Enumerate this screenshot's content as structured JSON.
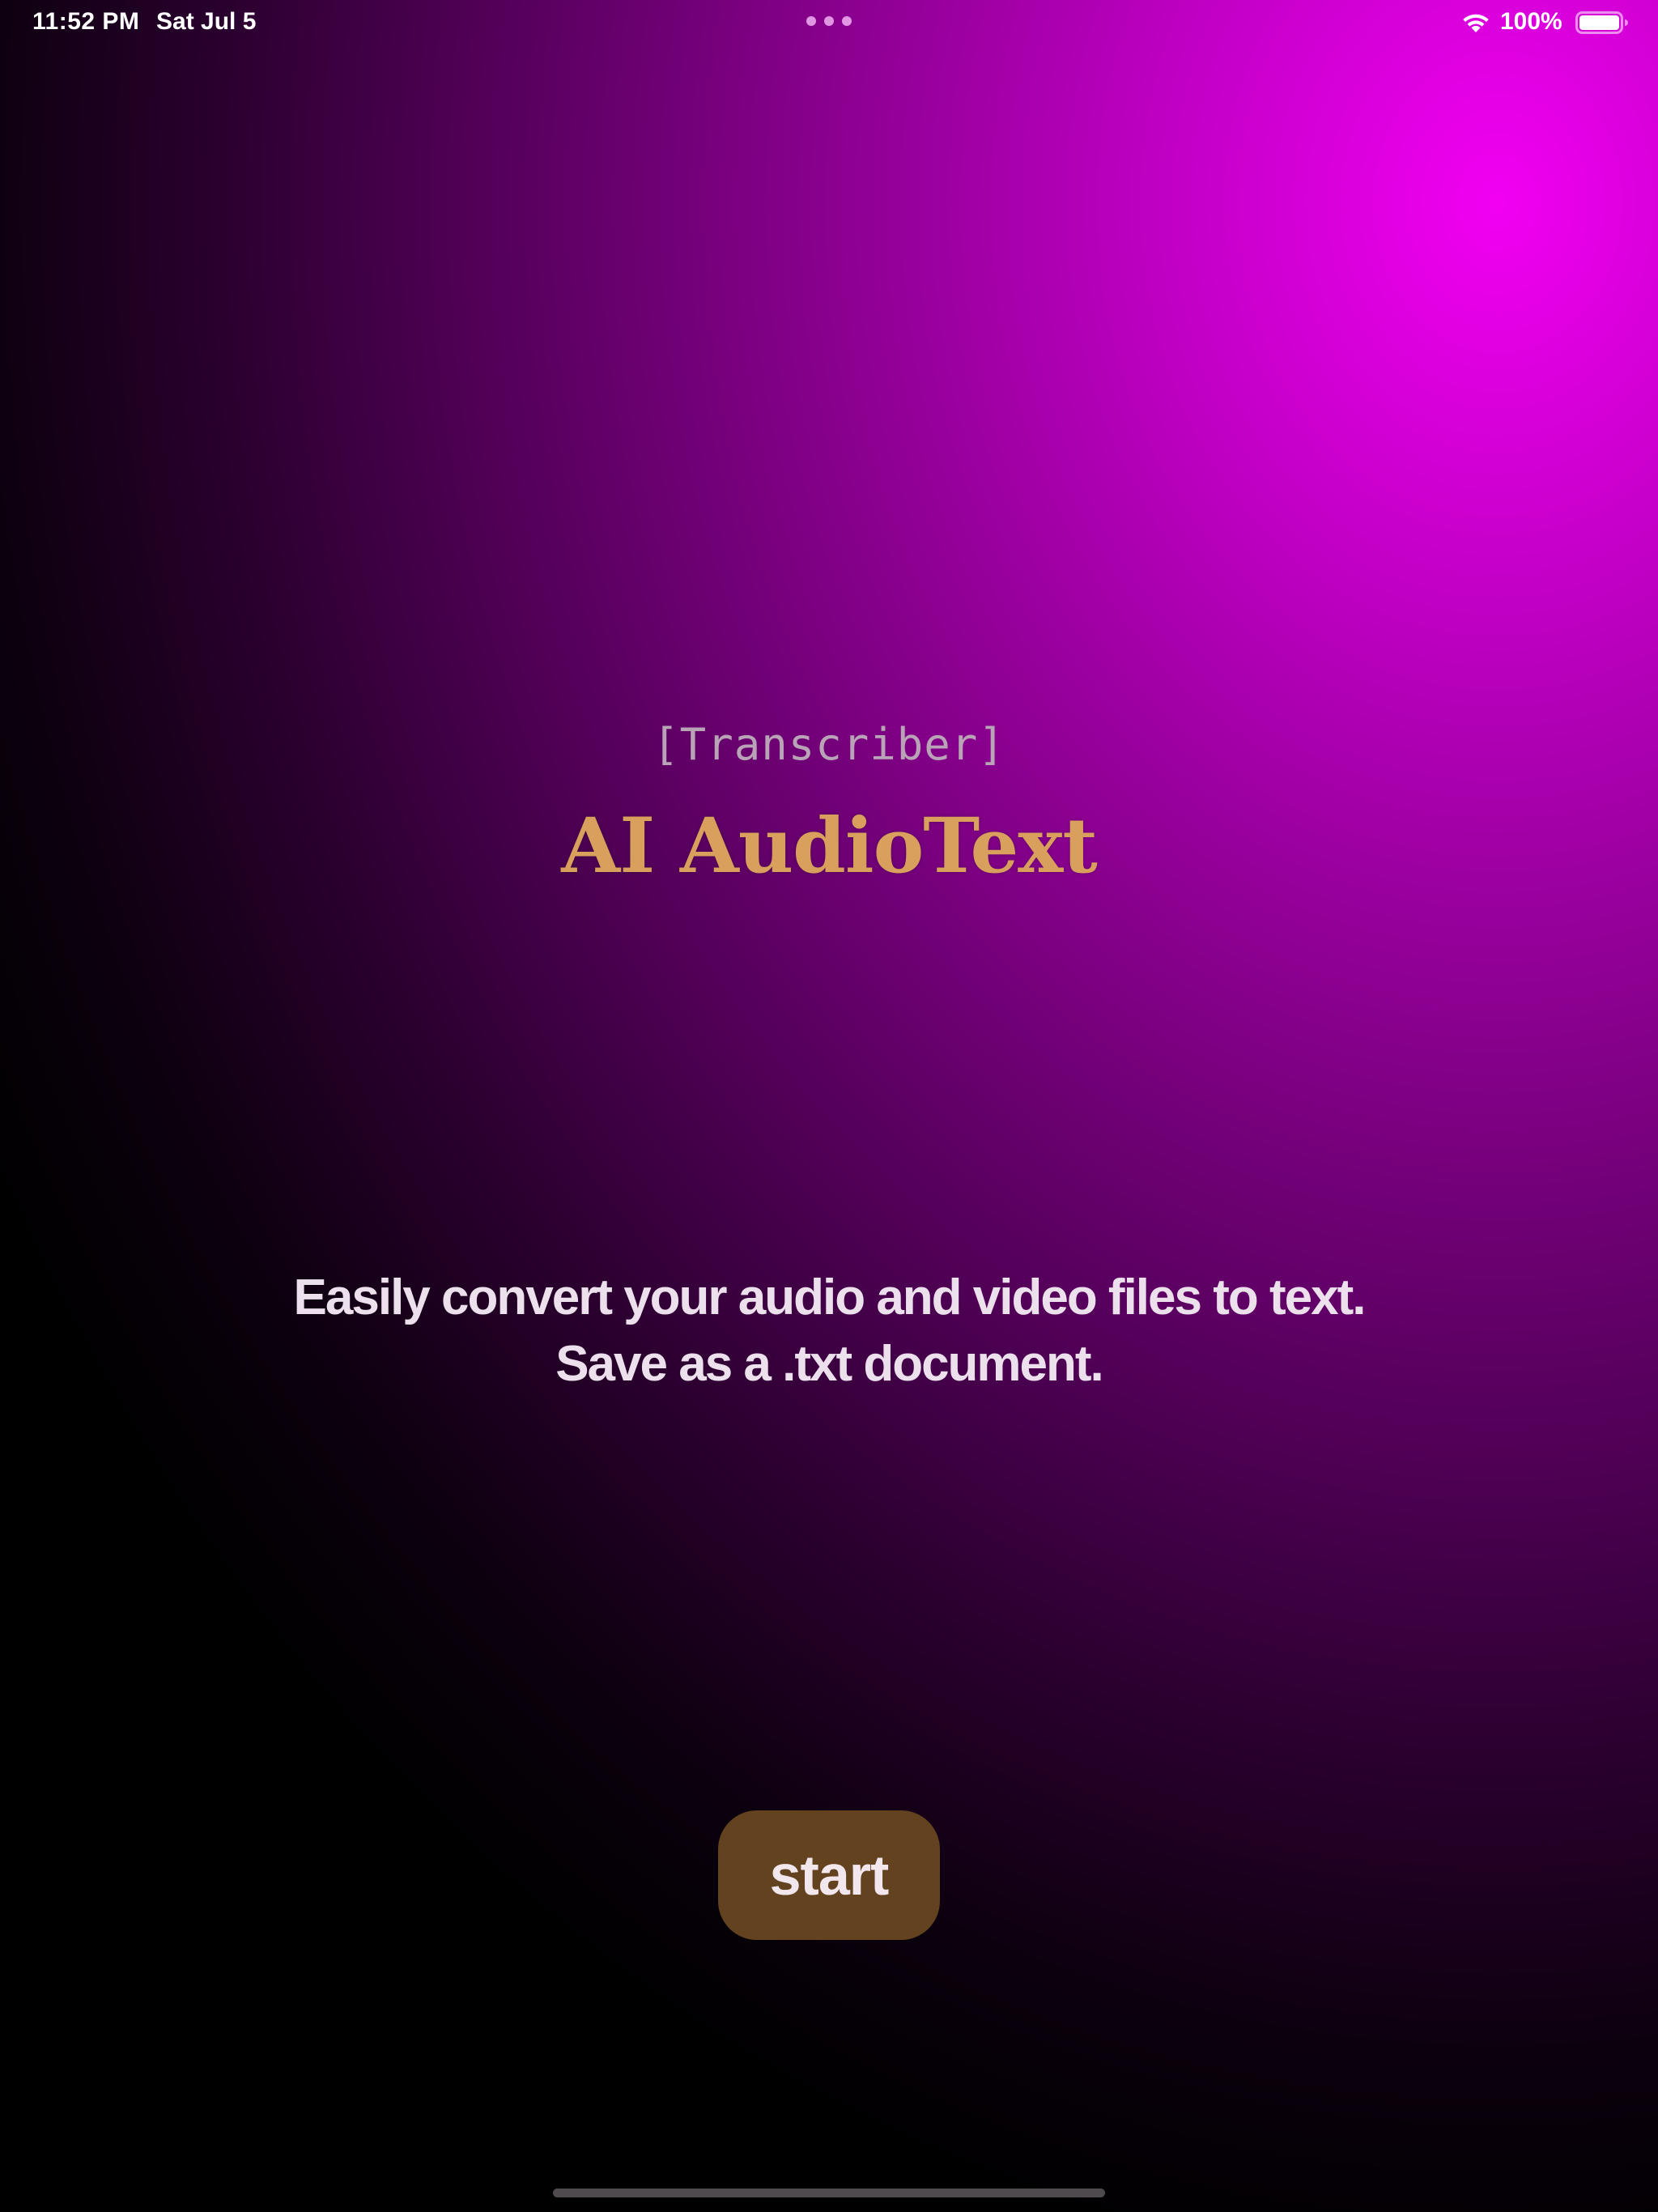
{
  "status_bar": {
    "time": "11:52 PM",
    "date": "Sat Jul 5",
    "battery_percent": "100%",
    "battery_level": 1.0,
    "icons": [
      "multitask-dots-icon",
      "wifi-icon",
      "battery-icon"
    ]
  },
  "main": {
    "subtitle": "[Transcriber]",
    "title": "AI AudioText",
    "description_lines": [
      "Easily convert your audio and video files to text.",
      "Save as a .txt document."
    ],
    "start_label": "start"
  },
  "colors": {
    "background_accent": "#f200f2",
    "background_base": "#000000",
    "title": "#d9a05d",
    "subtitle": "#b9a3b6",
    "description": "#ece0ec",
    "button_background": "#62421f",
    "button_text": "#f3e7ee"
  }
}
